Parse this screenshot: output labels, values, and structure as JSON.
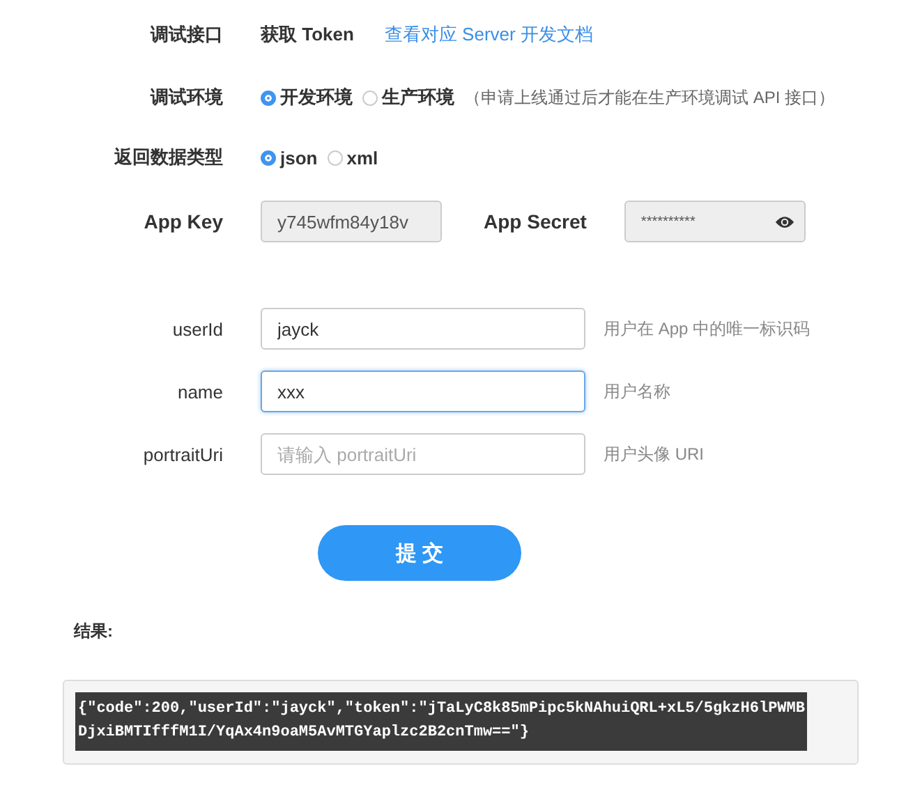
{
  "interface": {
    "label": "调试接口",
    "value": "获取 Token",
    "link": "查看对应 Server 开发文档"
  },
  "environment": {
    "label": "调试环境",
    "options": [
      {
        "label": "开发环境",
        "selected": true
      },
      {
        "label": "生产环境",
        "selected": false
      }
    ],
    "note": "（申请上线通过后才能在生产环境调试 API 接口）"
  },
  "data_type": {
    "label": "返回数据类型",
    "options": [
      {
        "label": "json",
        "selected": true
      },
      {
        "label": "xml",
        "selected": false
      }
    ]
  },
  "app_key": {
    "label": "App Key",
    "value": "y745wfm84y18v"
  },
  "app_secret": {
    "label": "App Secret",
    "value": "**********"
  },
  "fields": [
    {
      "label": "userId",
      "value": "jayck",
      "hint": "用户在 App 中的唯一标识码",
      "focused": false
    },
    {
      "label": "name",
      "value": "xxx",
      "hint": "用户名称",
      "focused": true
    },
    {
      "label": "portraitUri",
      "placeholder": "请输入 portraitUri",
      "hint": "用户头像 URI",
      "focused": false
    }
  ],
  "submit": "提 交",
  "result": {
    "label": "结果:",
    "text": "{\"code\":200,\"userId\":\"jayck\",\"token\":\"jTaLyC8k85mPipc5kNAhuiQRL+xL5/5gkzH6lPWMBDjxiBMTIfffM1I/YqAx4n9oaM5AvMTGYaplzc2B2cnTmw==\"}"
  }
}
